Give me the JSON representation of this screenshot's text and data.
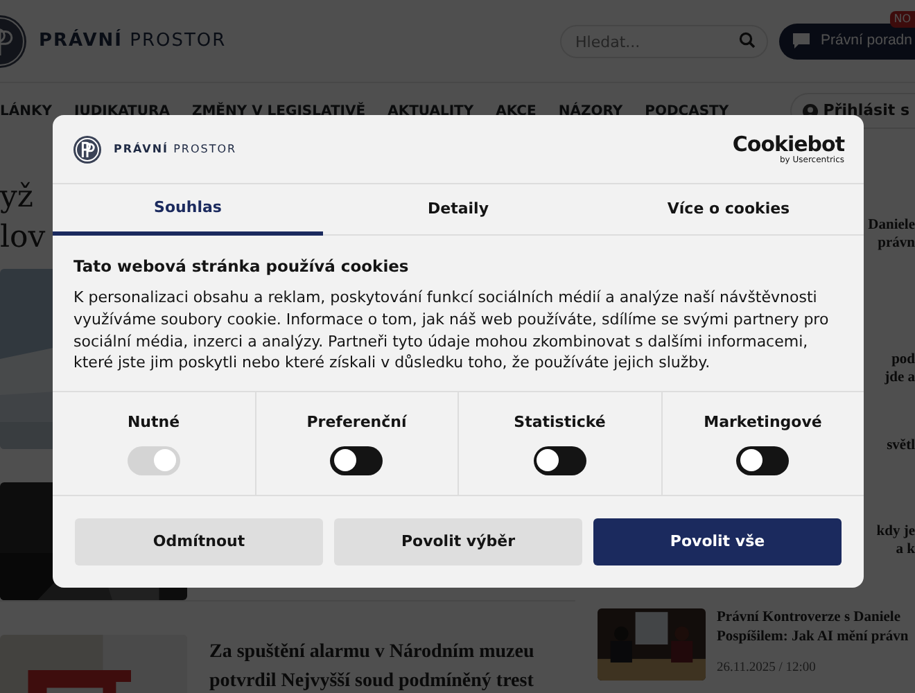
{
  "header": {
    "logo": "**PRÁVNÍ** PROSTOR",
    "search": {
      "placeholder": "Hledat..."
    },
    "advice_button": {
      "label": "Právní poradn",
      "badge": "NO"
    }
  },
  "nav": {
    "items": [
      {
        "label": "LÁNKY"
      },
      {
        "label": "JUDIKATURA"
      },
      {
        "label": "ZMĚNY V LEGISLATIVĚ"
      },
      {
        "label": "AKTUALITY"
      },
      {
        "label": "AKCE"
      },
      {
        "label": "NÁZORY"
      },
      {
        "label": "PODCASTY"
      }
    ],
    "login": "Přihlásit s"
  },
  "lead_article": {
    "title_lines": [
      "yž",
      "lov"
    ],
    "image": {
      "kind": "picture"
    }
  },
  "articles": [
    {
      "image": {
        "kind": "picture"
      }
    },
    {
      "image": {
        "kind": "picture"
      },
      "title": "Za spuštění alarmu v Národním muzeu potvrdil Nejvyšší soud podmíněný trest"
    }
  ],
  "sidebar": {
    "items": [
      {
        "title_lines": [
          "Daniele",
          "právn"
        ]
      },
      {
        "title_lines": [
          "pod",
          "jde a"
        ]
      },
      {
        "title_lines": [
          "světl"
        ]
      },
      {
        "title_lines": [
          "kdy je",
          "a k"
        ]
      },
      {
        "image": {
          "kind": "picture"
        },
        "title_lines": [
          "Právní Kontroverze s Daniele",
          "Pospíšilem: Jak AI mění právn"
        ],
        "date": "26.11.2025 / 12:00"
      }
    ]
  },
  "consent": {
    "logo": "**PRÁVNÍ** PROSTOR",
    "brand": "Cookiebot",
    "brand_sub": "by Usercentrics",
    "tabs": [
      {
        "label": "Souhlas",
        "selected": true
      },
      {
        "label": "Detaily",
        "selected": false
      },
      {
        "label": "Více o cookies",
        "selected": false
      }
    ],
    "heading": "Tato webová stránka používá cookies",
    "text": "K personalizaci obsahu a reklam, poskytování funkcí sociálních médií a analýze naší návštěvnosti využíváme soubory cookie. Informace o tom, jak náš web používáte, sdílíme se svými partnery pro sociální média, inzerci a analýzy. Partneři tyto údaje mohou zkombinovat s dalšími informacemi, které jste jim poskytli nebo které získali v důsledku toho, že používáte jejich služby.",
    "categories": [
      {
        "label": "Nutné",
        "on": true,
        "disabled": true
      },
      {
        "label": "Preferenční",
        "on": false,
        "disabled": false
      },
      {
        "label": "Statistické",
        "on": false,
        "disabled": false
      },
      {
        "label": "Marketingové",
        "on": false,
        "disabled": false
      }
    ],
    "buttons": [
      {
        "label": "Odmítnout",
        "kind": "secondary"
      },
      {
        "label": "Povolit výběr",
        "kind": "secondary"
      },
      {
        "label": "Povolit vše",
        "kind": "primary"
      }
    ]
  }
}
